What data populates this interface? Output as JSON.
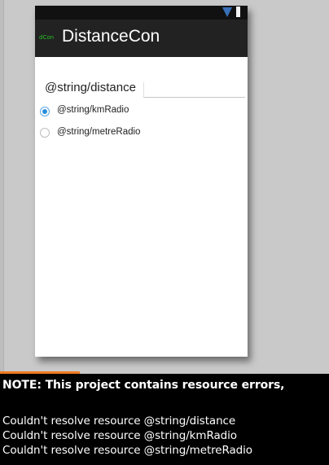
{
  "app": {
    "icon_label": "dCon",
    "title": "DistanceCon"
  },
  "form": {
    "distance_label": "@string/distance",
    "distance_value": "",
    "km_radio_label": "@string/kmRadio",
    "km_radio_checked": true,
    "metre_radio_label": "@string/metreRadio",
    "metre_radio_checked": false
  },
  "console": {
    "note": "NOTE: This project contains resource errors,",
    "errors": [
      "Couldn't resolve resource @string/distance",
      "Couldn't resolve resource @string/kmRadio",
      "Couldn't resolve resource @string/metreRadio"
    ]
  },
  "colors": {
    "status_bar": "#111111",
    "action_bar": "#222222",
    "accent": "#2a8ed8",
    "progress": "#f07a21",
    "canvas": "#c9c9c9",
    "console_bg": "#000000"
  }
}
